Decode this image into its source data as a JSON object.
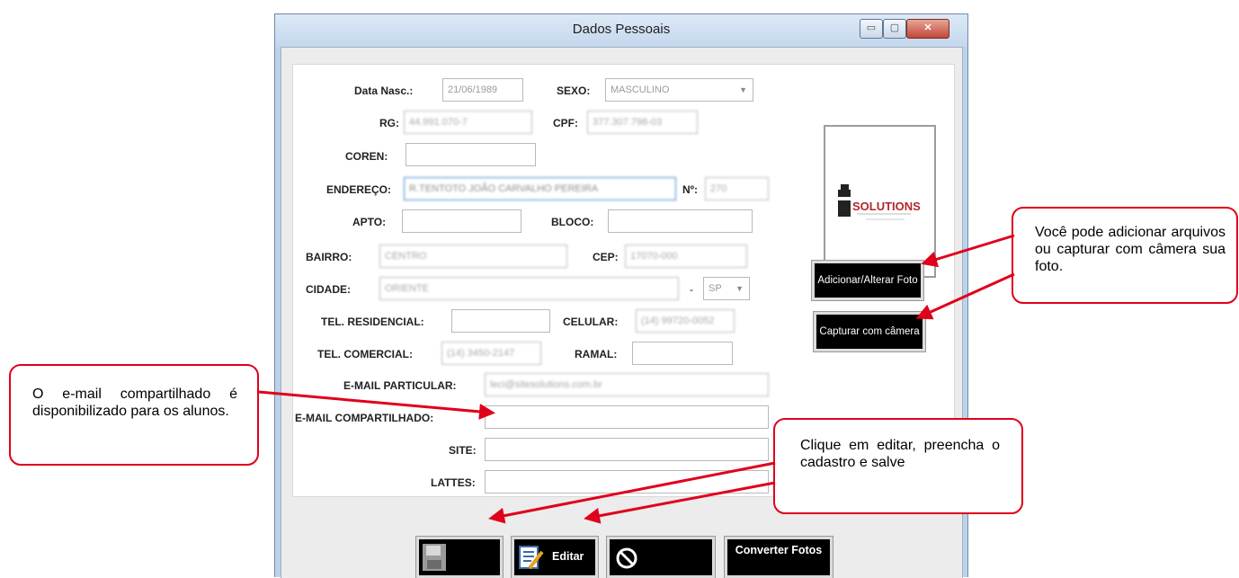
{
  "window": {
    "title": "Dados Pessoais",
    "minimize": "▭",
    "maximize": "▢",
    "close": "✕"
  },
  "form": {
    "data_nasc_label": "Data Nasc.:",
    "data_nasc_value": "21/06/1989",
    "sexo_label": "SEXO:",
    "sexo_value": "MASCULINO",
    "rg_label": "RG:",
    "rg_value": "44.991.070-7",
    "cpf_label": "CPF:",
    "cpf_value": "377.307.798-03",
    "coren_label": "COREN:",
    "coren_value": "",
    "endereco_label": "ENDEREÇO:",
    "endereco_value": "R.TENTOTO JOÃO CARVALHO PEREIRA",
    "numero_label": "Nº:",
    "numero_value": "270",
    "apto_label": "APTO:",
    "bloco_label": "BLOCO:",
    "bairro_label": "BAIRRO:",
    "bairro_value": "CENTRO",
    "cep_label": "CEP:",
    "cep_value": "17070-000",
    "cidade_label": "CIDADE:",
    "cidade_value": "ORIENTE",
    "uf_separator": "-",
    "uf_value": "SP",
    "tel_res_label": "TEL. RESIDENCIAL:",
    "celular_label": "CELULAR:",
    "celular_value": "(14) 99720-0052",
    "tel_com_label": "TEL. COMERCIAL:",
    "tel_com_value": "(14) 3450-2147",
    "ramal_label": "RAMAL:",
    "email_part_label": "E-MAIL PARTICULAR:",
    "email_part_value": "leci@sitesolutions.com.br",
    "email_comp_label": "E-MAIL COMPARTILHADO:",
    "site_label": "SITE:",
    "lattes_label": "LATTES:"
  },
  "photo": {
    "logo_text": "SOLUTIONS"
  },
  "buttons": {
    "add_photo": "Adicionar/Alterar Foto",
    "capture": "Capturar com câmera",
    "edit": "Editar",
    "convert": "Converter Fotos"
  },
  "callouts": {
    "photo": "Você pode adicionar arquivos ou capturar com câmera sua foto.",
    "email": "O e-mail compartilhado é disponibilizado para os alunos.",
    "edit": "Clique em editar, preencha o cadastro e salve"
  },
  "colors": {
    "callout_border": "#e0001b",
    "button_bg": "#000000",
    "title_bar": "#c4d7ee"
  }
}
